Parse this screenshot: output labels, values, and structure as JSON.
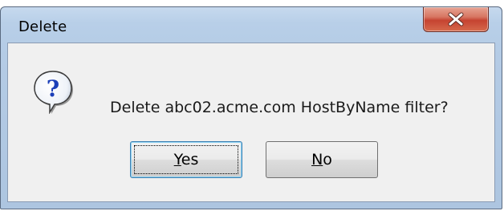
{
  "window": {
    "title": "Delete"
  },
  "dialog": {
    "message": "Delete abc02.acme.com HostByName filter?",
    "icon": "question-icon"
  },
  "buttons": {
    "yes": {
      "accel": "Y",
      "rest": "es"
    },
    "no": {
      "accel": "N",
      "rest": "o"
    }
  },
  "colors": {
    "close_button": "#c54331",
    "client_background": "#f0f0f0",
    "frame": "#b4cbe5"
  }
}
